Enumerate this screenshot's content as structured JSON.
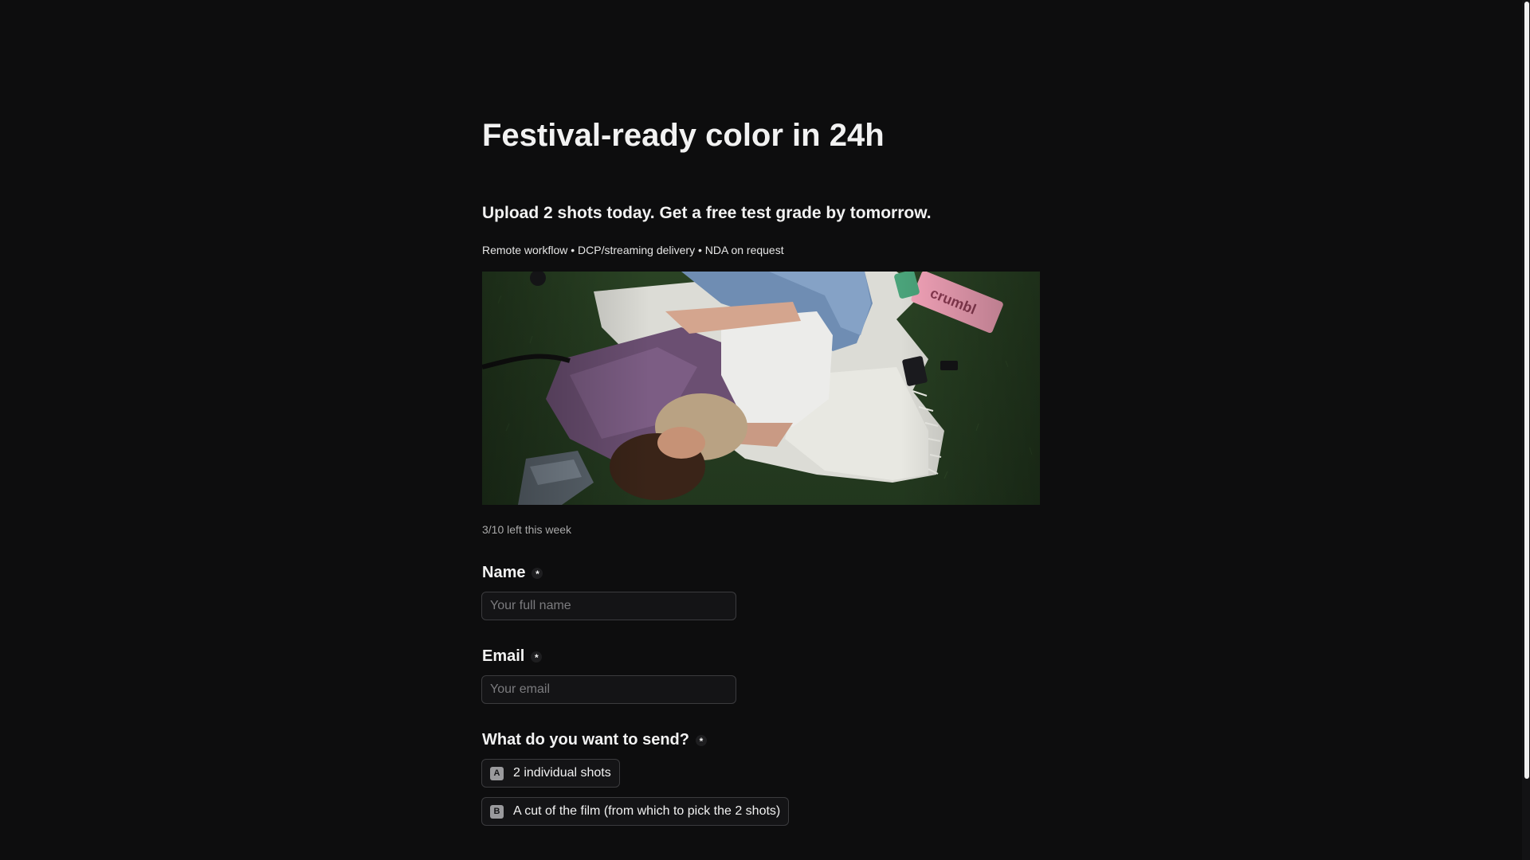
{
  "page": {
    "title": "Festival-ready color in 24h",
    "subtitle": "Upload 2 shots today. Get a free test grade by tomorrow.",
    "tagline": "Remote workflow • DCP/streaming delivery • NDA on request",
    "counter": "3/10 left this week"
  },
  "hero_image": {
    "box_label": "crumbl"
  },
  "form": {
    "name": {
      "label": "Name",
      "required_marker": "*",
      "placeholder": "Your full name",
      "value": ""
    },
    "email": {
      "label": "Email",
      "required_marker": "*",
      "placeholder": "Your email",
      "value": ""
    },
    "send": {
      "label": "What do you want to send?",
      "required_marker": "*",
      "options": [
        {
          "key": "A",
          "label": "2 individual shots"
        },
        {
          "key": "B",
          "label": "A cut of the film (from which to pick the 2 shots)"
        }
      ]
    }
  },
  "colors": {
    "background": "#0d0d0e",
    "text": "#f2f2f2",
    "muted": "#a9a9a9",
    "field_border": "#3b3b3e"
  }
}
